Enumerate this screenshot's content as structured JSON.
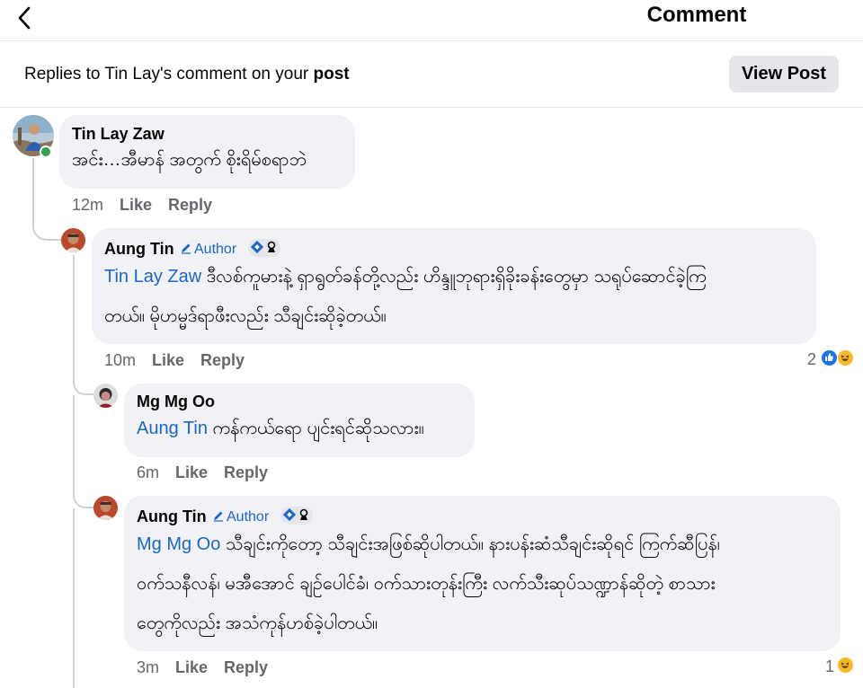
{
  "header": {
    "title": "Comment"
  },
  "replies_bar": {
    "prefix": "Replies to Tin Lay's comment on your ",
    "post_word": "post",
    "view_post_label": "View Post"
  },
  "comments": [
    {
      "author": "Tin Lay Zaw",
      "text": "အင်း…အီမာန် အတွက် စိုးရိမ်စရာဘဲ",
      "time": "12m",
      "like": "Like",
      "reply": "Reply"
    },
    {
      "author": "Aung Tin",
      "badge": "Author",
      "mention": "Tin Lay Zaw",
      "line1": " ဒီလစ်ကူမားနဲ့ ရှာရွတ်ခန်တို့လည်း ဟိန္ဒူဘုရားရှိခိုးခန်းတွေမှာ သရုပ်ဆောင်ခဲ့ကြ",
      "line2": "တယ်။ မိုဟမ္မဒ်ရာဖီးလည်း သီချင်းဆိုခဲ့တယ်။",
      "time": "10m",
      "like": "Like",
      "reply": "Reply",
      "reaction_count": "2"
    },
    {
      "author": "Mg Mg Oo",
      "mention": "Aung Tin",
      "text": " ကန်ကယ်ရော ပျင်းရင်ဆိုသလား။",
      "time": "6m",
      "like": "Like",
      "reply": "Reply"
    },
    {
      "author": "Aung Tin",
      "badge": "Author",
      "mention": "Mg Mg Oo",
      "line1": " သီချင်းကိုတော့ သီချင်းအဖြစ်ဆိုပါတယ်။ နားပန်းဆံသီချင်းဆိုရင် ကြက်ဆီပြန်၊",
      "line2": "ဝက်သနီလန်၊ မအီအောင် ချဉ်ပေါင်ခံ၊ ဝက်သားတုန်းကြီး လက်သီးဆုပ်သဏ္ဍာန်ဆိုတဲ့ စာသား",
      "line3": "တွေကိုလည်း အသံကုန်ဟစ်ခဲ့ပါတယ်။",
      "time": "3m",
      "like": "Like",
      "reply": "Reply",
      "reaction_count": "1"
    }
  ],
  "colors": {
    "accent": "#1b66c9",
    "bubble": "#f0f2f5",
    "online": "#31a24c"
  }
}
